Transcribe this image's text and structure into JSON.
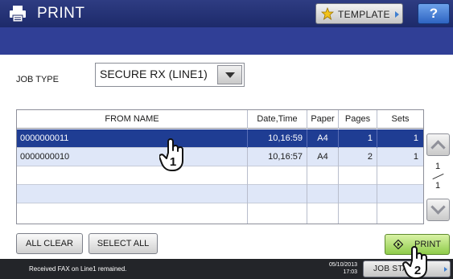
{
  "header": {
    "title": "PRINT",
    "app_icon": "printer-icon",
    "template_label": "TEMPLATE",
    "template_icon": "star-icon",
    "help_label": "?"
  },
  "job_type": {
    "label": "JOB TYPE",
    "value": "SECURE RX (LINE1)"
  },
  "table": {
    "columns": [
      "FROM NAME",
      "Date,Time",
      "Paper",
      "Pages",
      "Sets"
    ],
    "rows": [
      {
        "from_name": "0000000011",
        "date_time": "10,16:59",
        "paper": "A4",
        "pages": "1",
        "sets": "1",
        "selected": true
      },
      {
        "from_name": "0000000010",
        "date_time": "10,16:57",
        "paper": "A4",
        "pages": "2",
        "sets": "1",
        "selected": false
      }
    ]
  },
  "pagination": {
    "current": "1",
    "total": "1"
  },
  "buttons": {
    "all_clear": "ALL CLEAR",
    "select_all": "SELECT ALL",
    "print": "PRINT"
  },
  "status": {
    "message": "Received FAX on Line1 remained.",
    "date": "05/10/2013",
    "time": "17:03",
    "job_status_label": "JOB STATUS"
  },
  "annotations": {
    "step1": "1",
    "step2": "2"
  },
  "colors": {
    "title_bar": "#1d2a6a",
    "sub_bar": "#303f96",
    "selected_row": "#1f3d93",
    "alt_row": "#dfe7f8",
    "print_button": "#8fcc4a"
  }
}
